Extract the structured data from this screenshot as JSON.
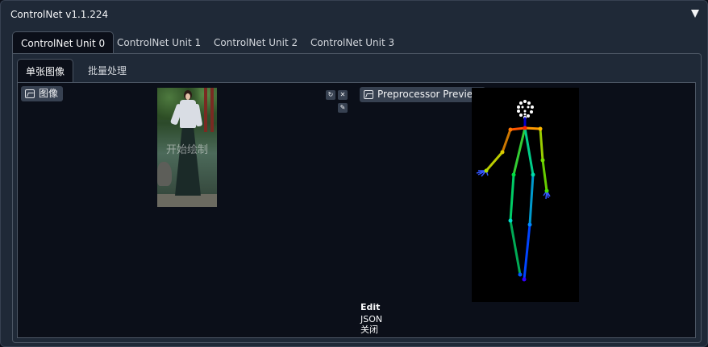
{
  "panel": {
    "title": "ControlNet v1.1.224",
    "collapse_icon": "triangle-down-icon"
  },
  "unit_tabs": [
    {
      "label": "ControlNet Unit 0",
      "active": true
    },
    {
      "label": "ControlNet Unit 1",
      "active": false
    },
    {
      "label": "ControlNet Unit 2",
      "active": false
    },
    {
      "label": "ControlNet Unit 3",
      "active": false
    }
  ],
  "image_tabs": [
    {
      "label": "单张图像",
      "active": true
    },
    {
      "label": "批量处理",
      "active": false
    }
  ],
  "image_input": {
    "label": "图像",
    "icon": "image-icon",
    "watermark": "开始绘制",
    "buttons": [
      "refresh-icon",
      "close-icon",
      "edit-pen-icon"
    ]
  },
  "preview": {
    "label": "Preprocessor Preview",
    "icon": "image-icon"
  },
  "preview_actions": {
    "edit": "Edit",
    "json": "JSON",
    "close": "关闭"
  },
  "colors": {
    "background": "#0b0f19",
    "panel": "#1f2937",
    "border": "#4b5563",
    "badge": "#374151"
  }
}
